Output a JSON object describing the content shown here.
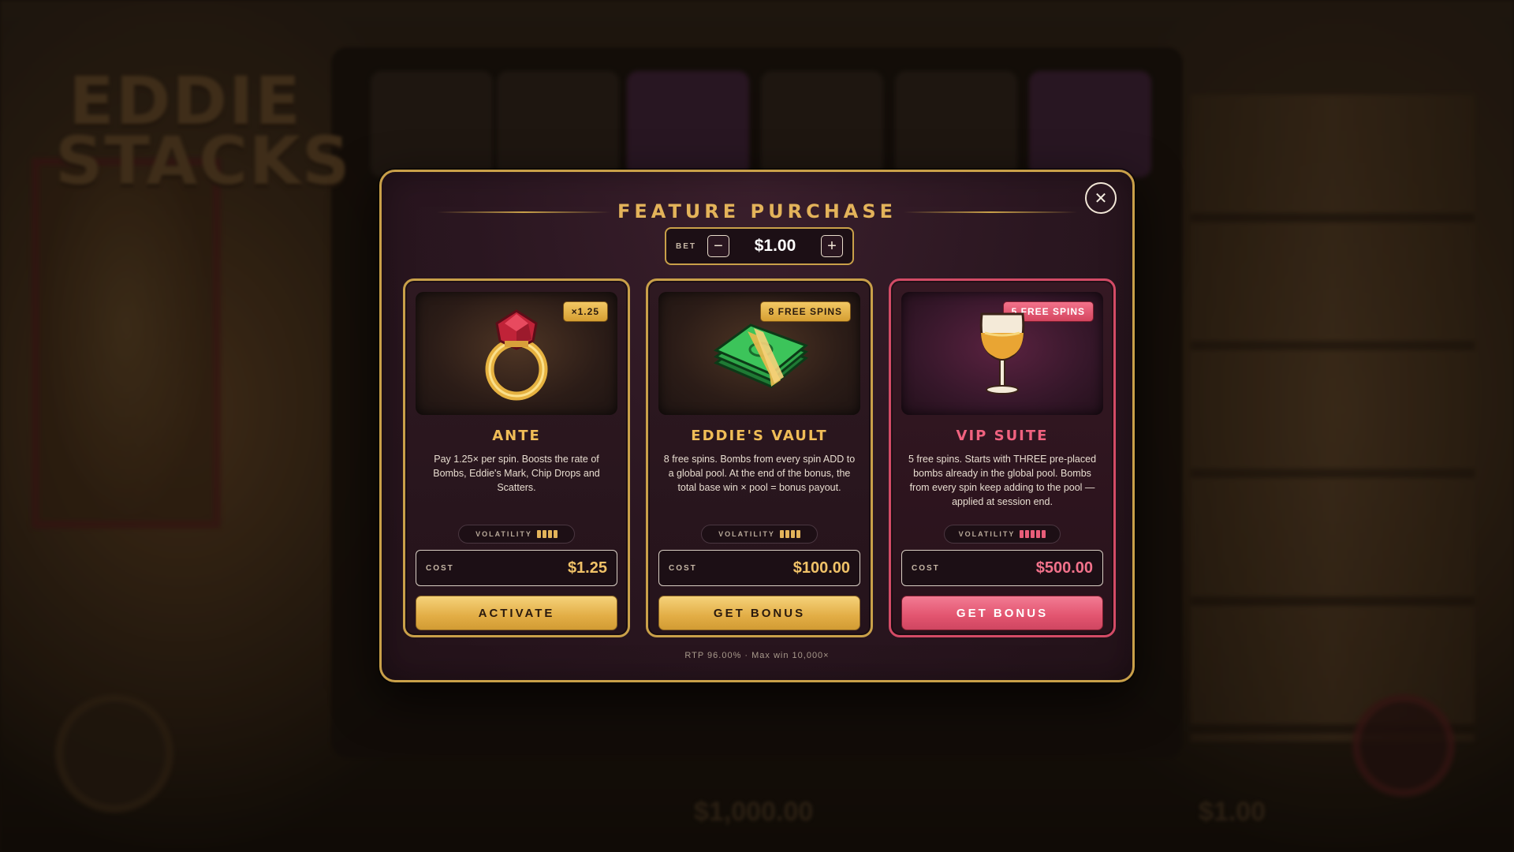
{
  "background": {
    "game_title_line1": "EDDIE",
    "game_title_line2": "STACKS",
    "balance": "$1,000.00",
    "bet": "$1.00"
  },
  "modal": {
    "title": "FEATURE PURCHASE",
    "close_icon": "close-icon",
    "bet": {
      "label": "BET",
      "value": "$1.00",
      "minus_icon": "minus-icon",
      "plus_icon": "plus-icon"
    },
    "cards": [
      {
        "id": "ante",
        "icon": "ring-icon",
        "badge": "×1.25",
        "title": "ANTE",
        "description": "Pay 1.25× per spin. Boosts the rate of Bombs, Eddie's Mark, Chip Drops and Scatters.",
        "volatility_label": "VOLATILITY",
        "volatility_level": 4,
        "volatility_max": 4,
        "cost_label": "COST",
        "cost": "$1.25",
        "button": "ACTIVATE",
        "accent": "#c9a049"
      },
      {
        "id": "eddies-vault",
        "icon": "cash-stack-icon",
        "badge": "8 FREE SPINS",
        "title": "EDDIE'S VAULT",
        "description": "8 free spins. Bombs from every spin ADD to a global pool. At the end of the bonus, the total base win × pool = bonus payout.",
        "volatility_label": "VOLATILITY",
        "volatility_level": 4,
        "volatility_max": 4,
        "cost_label": "COST",
        "cost": "$100.00",
        "button": "GET BONUS",
        "accent": "#c9a049"
      },
      {
        "id": "vip-suite",
        "icon": "wine-glass-icon",
        "badge": "5 FREE SPINS",
        "title": "VIP SUITE",
        "description": "5 free spins. Starts with THREE pre-placed bombs already in the global pool. Bombs from every spin keep adding to the pool — applied at session end.",
        "volatility_label": "VOLATILITY",
        "volatility_level": 5,
        "volatility_max": 5,
        "cost_label": "COST",
        "cost": "$500.00",
        "button": "GET BONUS",
        "accent": "#d34b66"
      }
    ],
    "footer": "RTP 96.00% · Max win 10,000×"
  }
}
